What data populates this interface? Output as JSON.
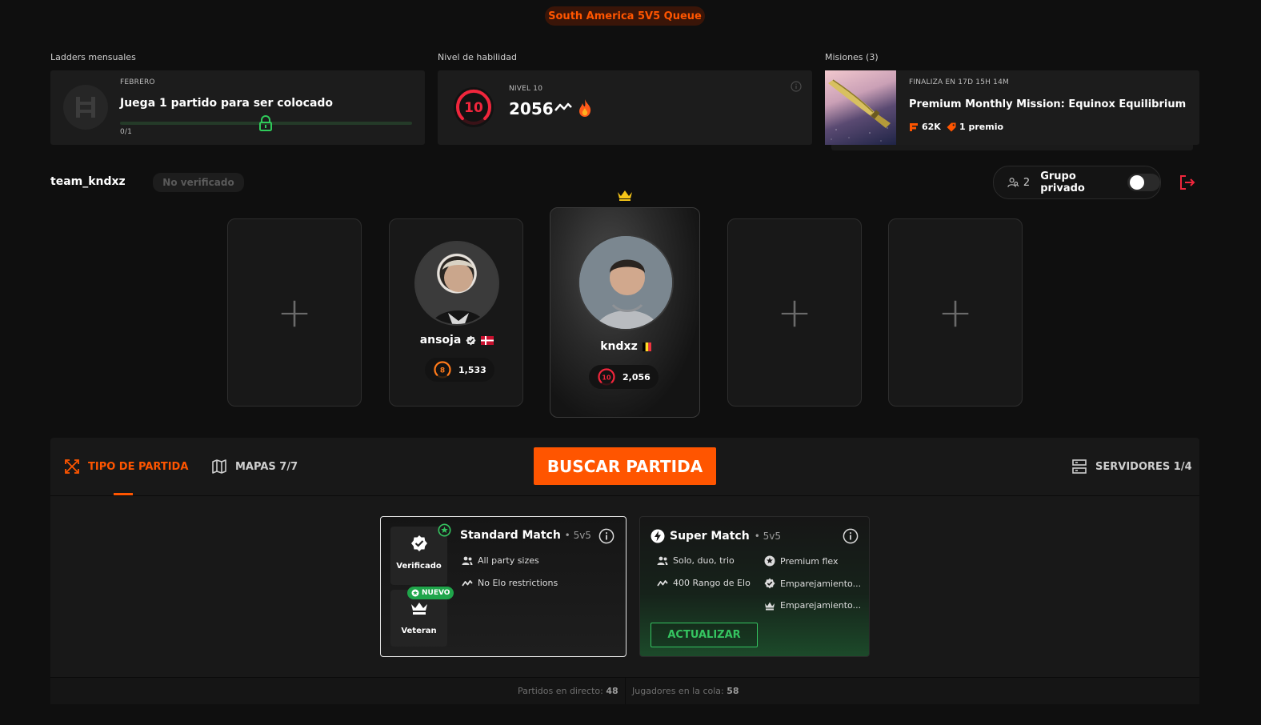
{
  "queue": {
    "label": "South America 5V5 Queue"
  },
  "ladders": {
    "section_label": "Ladders mensuales",
    "month": "FEBRERO",
    "objective": "Juega 1 partido para ser colocado",
    "progress_text": "0/1",
    "progress": 0
  },
  "skill": {
    "section_label": "Nivel de habilidad",
    "level_label": "NIVEL 10",
    "level": "10",
    "elo": "2056"
  },
  "missions": {
    "section_label": "Misiones (3)",
    "ends": "FINALIZA EN 17D 15H 14M",
    "title": "Premium Monthly Mission: Equinox Equilibrium",
    "points": "62K",
    "reward": "1 premio"
  },
  "team": {
    "name": "team_kndxz",
    "status": "No verificado",
    "group_count": "2",
    "group_label": "Grupo privado"
  },
  "players": [
    {
      "name": "ansoja",
      "level": "8",
      "elo": "1,533",
      "flag": "denmark"
    },
    {
      "name": "kndxz",
      "level": "10",
      "elo": "2,056",
      "flag": "belgium",
      "leader": true
    }
  ],
  "tabs": {
    "match_type": "TIPO DE PARTIDA",
    "maps": "MAPAS 7/7",
    "search": "BUSCAR PARTIDA",
    "servers": "SERVIDORES 1/4"
  },
  "modes": {
    "standard": {
      "title": "Standard Match",
      "sub": "• 5v5",
      "feature_1": "All party sizes",
      "feature_2": "No Elo restrictions",
      "tile_1": "Verificado",
      "tile_2": "Veteran",
      "new_badge": "NUEVO"
    },
    "super": {
      "title": "Super Match",
      "sub": "• 5v5",
      "feature_1": "Solo, duo, trio",
      "feature_2": "400 Rango de Elo",
      "feature_3": "Premium flex",
      "feature_4": "Emparejamiento...",
      "feature_5": "Emparejamiento...",
      "upgrade": "ACTUALIZAR"
    }
  },
  "footer": {
    "live_label": "Partidos en directo:",
    "live_value": "48",
    "queue_label": "Jugadores en la cola:",
    "queue_value": "58"
  },
  "colors": {
    "accent": "#ff5500",
    "green": "#35c460",
    "level_red": "#f0263c",
    "level_orange": "#ff7a1a"
  }
}
